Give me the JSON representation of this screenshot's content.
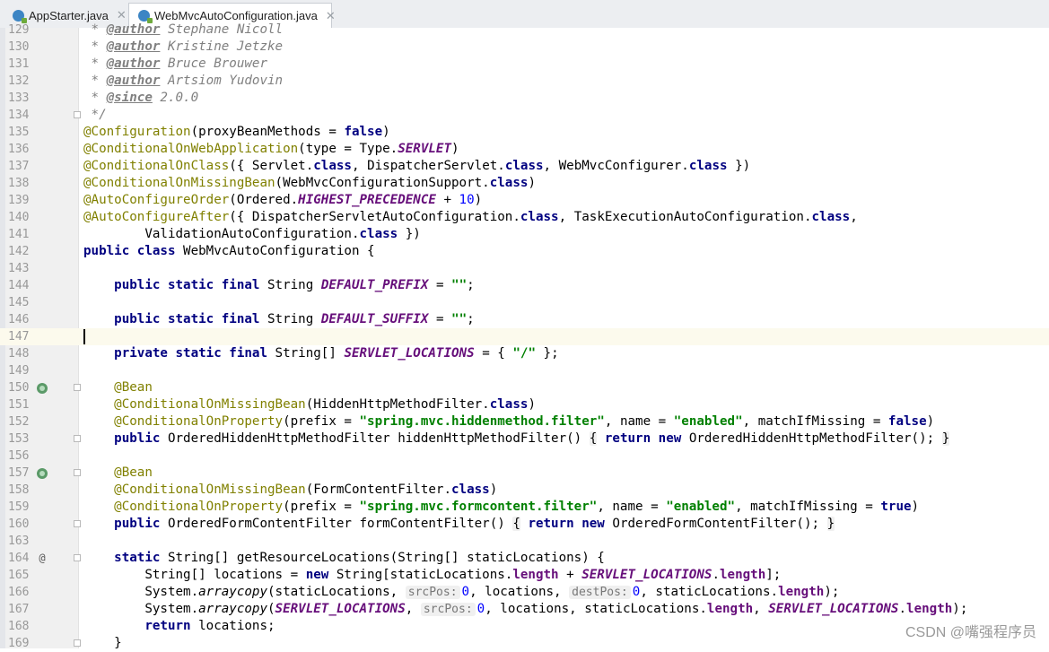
{
  "tabs": [
    {
      "label": "AppStarter.java",
      "active": false,
      "icon": "java-class-icon"
    },
    {
      "label": "WebMvcAutoConfiguration.java",
      "active": true,
      "icon": "java-class-icon"
    }
  ],
  "colors": {
    "keyword": "#000080",
    "annotation": "#808000",
    "string": "#008000",
    "constant": "#660e7a",
    "number": "#0000ff",
    "comment": "#808080",
    "line_number": "#999999",
    "current_line": "#fcfaed"
  },
  "watermark": "CSDN @嘴强程序员",
  "lines": [
    {
      "n": "129",
      "mark": "",
      "fold": false,
      "tokens": [
        [
          "cm",
          " * "
        ],
        [
          "tag",
          "@author"
        ],
        [
          "cm",
          " Stephane Nicoll"
        ]
      ]
    },
    {
      "n": "130",
      "mark": "",
      "fold": false,
      "tokens": [
        [
          "cm",
          " * "
        ],
        [
          "tag",
          "@author"
        ],
        [
          "cm",
          " Kristine Jetzke"
        ]
      ]
    },
    {
      "n": "131",
      "mark": "",
      "fold": false,
      "tokens": [
        [
          "cm",
          " * "
        ],
        [
          "tag",
          "@author"
        ],
        [
          "cm",
          " Bruce Brouwer"
        ]
      ]
    },
    {
      "n": "132",
      "mark": "",
      "fold": false,
      "tokens": [
        [
          "cm",
          " * "
        ],
        [
          "tag",
          "@author"
        ],
        [
          "cm",
          " Artsiom Yudovin"
        ]
      ]
    },
    {
      "n": "133",
      "mark": "",
      "fold": false,
      "tokens": [
        [
          "cm",
          " * "
        ],
        [
          "tag",
          "@since"
        ],
        [
          "cm",
          " 2.0.0"
        ]
      ]
    },
    {
      "n": "134",
      "mark": "",
      "fold": true,
      "tokens": [
        [
          "cm",
          " */"
        ]
      ]
    },
    {
      "n": "135",
      "mark": "",
      "fold": false,
      "tokens": [
        [
          "an",
          "@Configuration"
        ],
        [
          "",
          "(proxyBeanMethods = "
        ],
        [
          "kw",
          "false"
        ],
        [
          "",
          ")"
        ]
      ]
    },
    {
      "n": "136",
      "mark": "",
      "fold": false,
      "tokens": [
        [
          "an",
          "@ConditionalOnWebApplication"
        ],
        [
          "",
          "(type = Type."
        ],
        [
          "cn",
          "SERVLET"
        ],
        [
          "",
          ")"
        ]
      ]
    },
    {
      "n": "137",
      "mark": "",
      "fold": false,
      "tokens": [
        [
          "an",
          "@ConditionalOnClass"
        ],
        [
          "",
          "({ Servlet."
        ],
        [
          "kw",
          "class"
        ],
        [
          "",
          ", DispatcherServlet."
        ],
        [
          "kw",
          "class"
        ],
        [
          "",
          ", WebMvcConfigurer."
        ],
        [
          "kw",
          "class"
        ],
        [
          "",
          " })"
        ]
      ]
    },
    {
      "n": "138",
      "mark": "",
      "fold": false,
      "tokens": [
        [
          "an",
          "@ConditionalOnMissingBean"
        ],
        [
          "",
          "(WebMvcConfigurationSupport."
        ],
        [
          "kw",
          "class"
        ],
        [
          "",
          ")"
        ]
      ]
    },
    {
      "n": "139",
      "mark": "",
      "fold": false,
      "tokens": [
        [
          "an",
          "@AutoConfigureOrder"
        ],
        [
          "",
          "(Ordered."
        ],
        [
          "cn",
          "HIGHEST_PRECEDENCE"
        ],
        [
          "",
          " + "
        ],
        [
          "num",
          "10"
        ],
        [
          "",
          ")"
        ]
      ]
    },
    {
      "n": "140",
      "mark": "",
      "fold": false,
      "tokens": [
        [
          "an",
          "@AutoConfigureAfter"
        ],
        [
          "",
          "({ DispatcherServletAutoConfiguration."
        ],
        [
          "kw",
          "class"
        ],
        [
          "",
          ", TaskExecutionAutoConfiguration."
        ],
        [
          "kw",
          "class"
        ],
        [
          "",
          ","
        ]
      ]
    },
    {
      "n": "141",
      "mark": "",
      "fold": false,
      "tokens": [
        [
          "",
          "        ValidationAutoConfiguration."
        ],
        [
          "kw",
          "class"
        ],
        [
          "",
          " })"
        ]
      ]
    },
    {
      "n": "142",
      "mark": "",
      "fold": false,
      "tokens": [
        [
          "kw",
          "public class"
        ],
        [
          "",
          " WebMvcAutoConfiguration {"
        ]
      ]
    },
    {
      "n": "143",
      "mark": "",
      "fold": false,
      "tokens": []
    },
    {
      "n": "144",
      "mark": "",
      "fold": false,
      "tokens": [
        [
          "",
          "    "
        ],
        [
          "kw",
          "public static final"
        ],
        [
          "",
          " String "
        ],
        [
          "cn",
          "DEFAULT_PREFIX"
        ],
        [
          "",
          " = "
        ],
        [
          "st",
          "\"\""
        ],
        [
          "",
          ";"
        ]
      ]
    },
    {
      "n": "145",
      "mark": "",
      "fold": false,
      "tokens": []
    },
    {
      "n": "146",
      "mark": "",
      "fold": false,
      "tokens": [
        [
          "",
          "    "
        ],
        [
          "kw",
          "public static final"
        ],
        [
          "",
          " String "
        ],
        [
          "cn",
          "DEFAULT_SUFFIX"
        ],
        [
          "",
          " = "
        ],
        [
          "st",
          "\"\""
        ],
        [
          "",
          ";"
        ]
      ]
    },
    {
      "n": "147",
      "mark": "",
      "fold": false,
      "current": true,
      "tokens": [
        [
          "caret",
          ""
        ]
      ]
    },
    {
      "n": "148",
      "mark": "",
      "fold": false,
      "tokens": [
        [
          "",
          "    "
        ],
        [
          "kw",
          "private static final"
        ],
        [
          "",
          " String[] "
        ],
        [
          "cn",
          "SERVLET_LOCATIONS"
        ],
        [
          "",
          " = { "
        ],
        [
          "st",
          "\"/\""
        ],
        [
          "",
          " };"
        ]
      ]
    },
    {
      "n": "149",
      "mark": "",
      "fold": false,
      "tokens": []
    },
    {
      "n": "150",
      "mark": "bean",
      "fold": true,
      "tokens": [
        [
          "",
          "    "
        ],
        [
          "an",
          "@Bean"
        ]
      ]
    },
    {
      "n": "151",
      "mark": "",
      "fold": false,
      "tokens": [
        [
          "",
          "    "
        ],
        [
          "an",
          "@ConditionalOnMissingBean"
        ],
        [
          "",
          "(HiddenHttpMethodFilter."
        ],
        [
          "kw",
          "class"
        ],
        [
          "",
          ")"
        ]
      ]
    },
    {
      "n": "152",
      "mark": "",
      "fold": false,
      "tokens": [
        [
          "",
          "    "
        ],
        [
          "an",
          "@ConditionalOnProperty"
        ],
        [
          "",
          "(prefix = "
        ],
        [
          "st",
          "\"spring.mvc.hiddenmethod.filter\""
        ],
        [
          "",
          ", name = "
        ],
        [
          "st",
          "\"enabled\""
        ],
        [
          "",
          ", matchIfMissing = "
        ],
        [
          "kw",
          "false"
        ],
        [
          "",
          ")"
        ]
      ]
    },
    {
      "n": "153",
      "mark": "",
      "fold": true,
      "tokens": [
        [
          "",
          "    "
        ],
        [
          "kw",
          "public"
        ],
        [
          "",
          " OrderedHiddenHttpMethodFilter hiddenHttpMethodFilter() "
        ],
        [
          "brace",
          "{"
        ],
        [
          "",
          " "
        ],
        [
          "kw",
          "return new"
        ],
        [
          "",
          " OrderedHiddenHttpMethodFilter(); "
        ],
        [
          "brace",
          "}"
        ]
      ]
    },
    {
      "n": "156",
      "mark": "",
      "fold": false,
      "tokens": []
    },
    {
      "n": "157",
      "mark": "bean",
      "fold": true,
      "tokens": [
        [
          "",
          "    "
        ],
        [
          "an",
          "@Bean"
        ]
      ]
    },
    {
      "n": "158",
      "mark": "",
      "fold": false,
      "tokens": [
        [
          "",
          "    "
        ],
        [
          "an",
          "@ConditionalOnMissingBean"
        ],
        [
          "",
          "(FormContentFilter."
        ],
        [
          "kw",
          "class"
        ],
        [
          "",
          ")"
        ]
      ]
    },
    {
      "n": "159",
      "mark": "",
      "fold": false,
      "tokens": [
        [
          "",
          "    "
        ],
        [
          "an",
          "@ConditionalOnProperty"
        ],
        [
          "",
          "(prefix = "
        ],
        [
          "st",
          "\"spring.mvc.formcontent.filter\""
        ],
        [
          "",
          ", name = "
        ],
        [
          "st",
          "\"enabled\""
        ],
        [
          "",
          ", matchIfMissing = "
        ],
        [
          "kw",
          "true"
        ],
        [
          "",
          ")"
        ]
      ]
    },
    {
      "n": "160",
      "mark": "",
      "fold": true,
      "tokens": [
        [
          "",
          "    "
        ],
        [
          "kw",
          "public"
        ],
        [
          "",
          " OrderedFormContentFilter formContentFilter() "
        ],
        [
          "brace",
          "{"
        ],
        [
          "",
          " "
        ],
        [
          "kw",
          "return new"
        ],
        [
          "",
          " OrderedFormContentFilter(); "
        ],
        [
          "brace",
          "}"
        ]
      ]
    },
    {
      "n": "163",
      "mark": "",
      "fold": false,
      "tokens": []
    },
    {
      "n": "164",
      "mark": "@",
      "fold": true,
      "tokens": [
        [
          "",
          "    "
        ],
        [
          "kw",
          "static"
        ],
        [
          "",
          " String[] getResourceLocations(String[] staticLocations) {"
        ]
      ]
    },
    {
      "n": "165",
      "mark": "",
      "fold": false,
      "tokens": [
        [
          "",
          "        String[] locations = "
        ],
        [
          "kw",
          "new"
        ],
        [
          "",
          " String[staticLocations."
        ],
        [
          "fld",
          "length"
        ],
        [
          "",
          " + "
        ],
        [
          "cn",
          "SERVLET_LOCATIONS"
        ],
        [
          "",
          "."
        ],
        [
          "fld",
          "length"
        ],
        [
          "",
          "];"
        ]
      ]
    },
    {
      "n": "166",
      "mark": "",
      "fold": false,
      "tokens": [
        [
          "",
          "        System."
        ],
        [
          "sm",
          "arraycopy"
        ],
        [
          "",
          "(staticLocations, "
        ],
        [
          "hint",
          "srcPos:"
        ],
        [
          "num",
          "0"
        ],
        [
          "",
          ", locations, "
        ],
        [
          "hint",
          "destPos:"
        ],
        [
          "num",
          "0"
        ],
        [
          "",
          ", staticLocations."
        ],
        [
          "fld",
          "length"
        ],
        [
          "",
          ");"
        ]
      ]
    },
    {
      "n": "167",
      "mark": "",
      "fold": false,
      "tokens": [
        [
          "",
          "        System."
        ],
        [
          "sm",
          "arraycopy"
        ],
        [
          "",
          "("
        ],
        [
          "cn",
          "SERVLET_LOCATIONS"
        ],
        [
          "",
          ", "
        ],
        [
          "hint",
          "srcPos:"
        ],
        [
          "num",
          "0"
        ],
        [
          "",
          ", locations, staticLocations."
        ],
        [
          "fld",
          "length"
        ],
        [
          "",
          ", "
        ],
        [
          "cn",
          "SERVLET_LOCATIONS"
        ],
        [
          "",
          "."
        ],
        [
          "fld",
          "length"
        ],
        [
          "",
          ");"
        ]
      ]
    },
    {
      "n": "168",
      "mark": "",
      "fold": false,
      "tokens": [
        [
          "",
          "        "
        ],
        [
          "kw",
          "return"
        ],
        [
          "",
          " locations;"
        ]
      ]
    },
    {
      "n": "169",
      "mark": "",
      "fold": true,
      "tokens": [
        [
          "",
          "    }"
        ]
      ]
    }
  ]
}
